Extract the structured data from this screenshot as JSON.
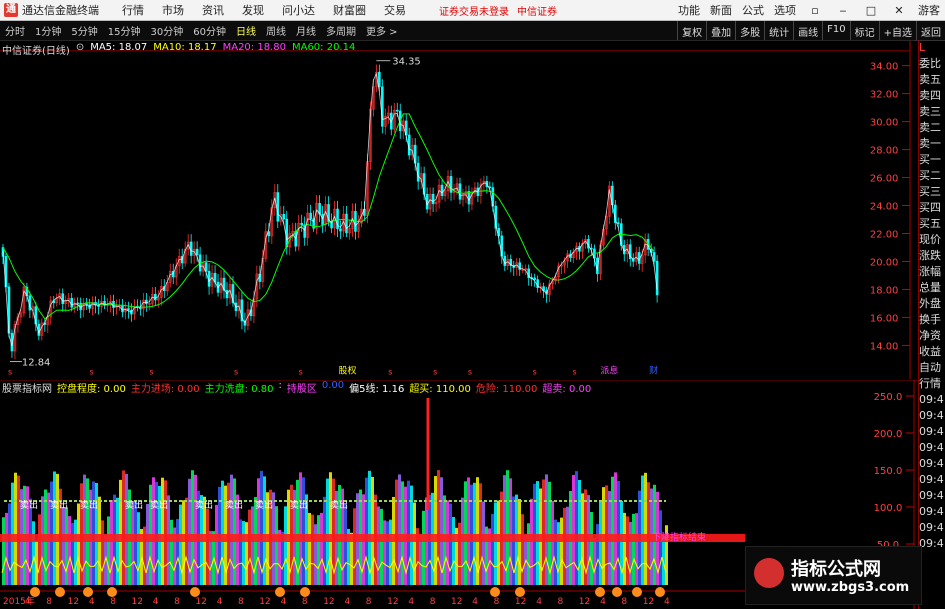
{
  "titlebar": {
    "app_title": "通达信金融终端",
    "menus": [
      "行情",
      "市场",
      "资讯",
      "发现",
      "问小达",
      "财富圈",
      "交易"
    ],
    "status_text": "证券交易未登录",
    "broker": "中信证券",
    "right_items": [
      "功能",
      "新面",
      "公式",
      "选项"
    ],
    "user": "游客"
  },
  "toolbar": {
    "timeframes": [
      "分时",
      "1分钟",
      "5分钟",
      "15分钟",
      "30分钟",
      "60分钟",
      "日线",
      "周线",
      "月线",
      "多周期",
      "更多 >"
    ],
    "active": "日线",
    "right_buttons": [
      "复权",
      "叠加",
      "多股",
      "统计",
      "画线",
      "F10",
      "标记",
      "+自选",
      "返回"
    ]
  },
  "main": {
    "stock_name": "中信证券(日线)",
    "ma": [
      {
        "label": "MA5: 18.07",
        "color": "#ffffff"
      },
      {
        "label": "MA10: 18.17",
        "color": "#ffff00"
      },
      {
        "label": "MA20: 18.80",
        "color": "#ff40ff"
      },
      {
        "label": "MA60: 20.14",
        "color": "#00ff00"
      }
    ],
    "high_label": "34.35",
    "low_label": "12.84",
    "price_axis": [
      "34.00",
      "32.00",
      "30.00",
      "28.00",
      "26.00",
      "24.00",
      "22.00",
      "20.00",
      "18.00",
      "16.00",
      "14.00"
    ],
    "bottom_markers": [
      "股权",
      "派息",
      "财"
    ]
  },
  "indicator": {
    "name": "股票指标网",
    "items": [
      {
        "label": "控盘程度: 0.00",
        "color": "#ffff00"
      },
      {
        "label": "主力进场: 0.00",
        "color": "#ff3030"
      },
      {
        "label": "主力洗盘: 0.80",
        "color": "#00ff00"
      },
      {
        "label": ":",
        "color": "#cccccc"
      },
      {
        "label": "持股区",
        "color": "#ff40ff"
      },
      {
        "label": "0.00",
        "color": "#3060ff"
      },
      {
        "label": "偏5线: 1.16",
        "color": "#ffffff"
      },
      {
        "label": "超买: 110.00",
        "color": "#ffff00"
      },
      {
        "label": "危险: 110.00",
        "color": "#ff3030"
      },
      {
        "label": "超卖: 0.00",
        "color": "#ff40ff"
      }
    ],
    "axis": [
      "250.0",
      "200.0",
      "150.0",
      "100.0",
      "50.0"
    ],
    "annotations": [
      "卖出",
      "卖出",
      "卖出",
      "卖出",
      "卖出",
      "卖出",
      "卖出",
      "卖出",
      "卖出",
      "卖出"
    ],
    "banner": "下降指标结束"
  },
  "right_panel": {
    "top": [
      "L",
      "委比",
      "卖五",
      "卖四",
      "卖三",
      "卖二",
      "卖一",
      "买一",
      "买二",
      "买三",
      "买四",
      "买五",
      "现价",
      "涨跌",
      "涨幅",
      "总量",
      "外盘",
      "换手",
      "净资",
      "收益"
    ],
    "bottom": [
      "自动",
      "行情",
      "09:4",
      "09:4",
      "09:4",
      "09:4",
      "09:4",
      "09:4",
      "09:4",
      "09:4",
      "09:4",
      "09:4"
    ]
  },
  "time_axis": {
    "labels": [
      "2015年",
      "4",
      "8",
      "12",
      "4",
      "8",
      "12",
      "4",
      "8",
      "12",
      "4",
      "8",
      "12",
      "4",
      "8",
      "12",
      "4",
      "8",
      "12",
      "4",
      "8",
      "12",
      "4",
      "8",
      "12",
      "4",
      "8",
      "12",
      "4",
      "8",
      "12",
      "4"
    ]
  },
  "watermark": {
    "title": "指标公式网",
    "url": "www.zbgs3.com"
  },
  "colors": {
    "up": "#ff3030",
    "down": "#00ffff",
    "ma5": "#ffffff",
    "ma10": "#ffff00",
    "ma20": "#ff40ff",
    "ma60": "#00ff00",
    "grid": "#7a0000"
  }
}
